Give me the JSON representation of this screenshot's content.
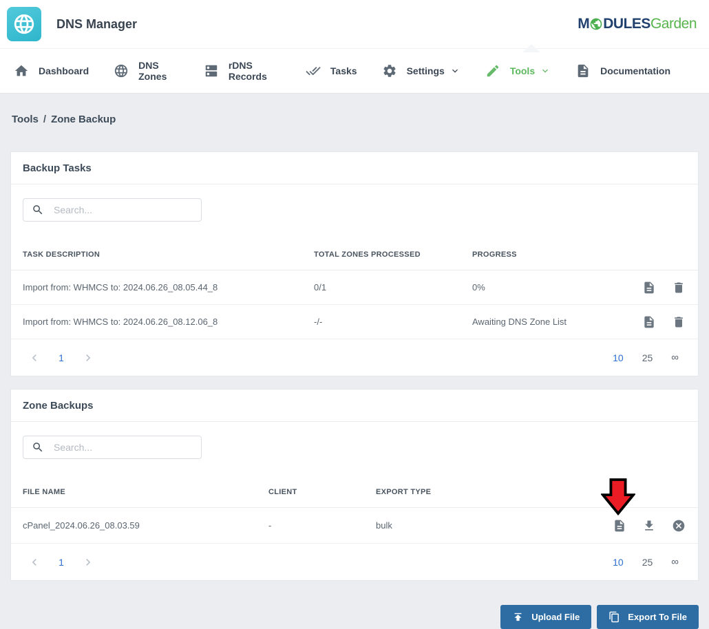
{
  "header": {
    "app_title": "DNS Manager",
    "logo": {
      "m": "M",
      "dules": "DULES",
      "garden": "Garden"
    }
  },
  "nav": {
    "items": [
      {
        "label": "Dashboard",
        "icon": "home-icon",
        "active": false
      },
      {
        "label": "DNS Zones",
        "icon": "globe-icon",
        "active": false
      },
      {
        "label": "rDNS Records",
        "icon": "dns-server-icon",
        "active": false
      },
      {
        "label": "Tasks",
        "icon": "done-all-icon",
        "active": false
      },
      {
        "label": "Settings",
        "icon": "gear-icon",
        "dropdown": true,
        "active": false
      },
      {
        "label": "Tools",
        "icon": "pencil-icon",
        "dropdown": true,
        "active": true
      },
      {
        "label": "Documentation",
        "icon": "document-icon",
        "active": false
      }
    ]
  },
  "breadcrumb": {
    "section": "Tools",
    "separator": "/",
    "page": "Zone Backup"
  },
  "backup_tasks": {
    "title": "Backup Tasks",
    "search_placeholder": "Search...",
    "columns": {
      "c1": "TASK DESCRIPTION",
      "c2": "TOTAL ZONES PROCESSED",
      "c3": "PROGRESS"
    },
    "rows": [
      {
        "description": "Import from: WHMCS to: 2024.06.26_08.05.44_8",
        "total": "0/1",
        "progress": "0%"
      },
      {
        "description": "Import from: WHMCS to: 2024.06.26_08.12.06_8",
        "total": "-/-",
        "progress": "Awaiting DNS Zone List"
      }
    ],
    "pagination": {
      "page": "1",
      "size_10": "10",
      "size_25": "25",
      "size_inf": "∞",
      "active_size": "10"
    }
  },
  "zone_backups": {
    "title": "Zone Backups",
    "search_placeholder": "Search...",
    "columns": {
      "c1": "FILE NAME",
      "c2": "CLIENT",
      "c3": "EXPORT TYPE"
    },
    "rows": [
      {
        "file_name": "cPanel_2024.06.26_08.03.59",
        "client": "-",
        "export_type": "bulk"
      }
    ],
    "pagination": {
      "page": "1",
      "size_10": "10",
      "size_25": "25",
      "size_inf": "∞",
      "active_size": "10"
    }
  },
  "footer": {
    "upload_label": "Upload File",
    "export_label": "Export To File"
  },
  "colors": {
    "accent_green": "#5cb85c",
    "button_blue": "#2e6da4",
    "pagination_blue": "#2e6fd0",
    "app_icon_teal": "#38bdd3",
    "arrow_red": "#ec1c24",
    "logo_navy": "#21416f",
    "logo_green": "#58b44c",
    "page_background": "#ebedf0"
  }
}
